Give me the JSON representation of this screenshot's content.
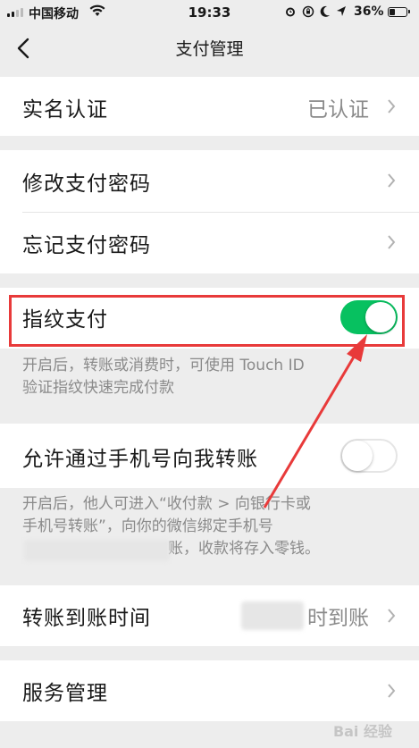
{
  "status_bar": {
    "carrier": "中国移动",
    "time": "19:33",
    "battery": "36%"
  },
  "nav": {
    "title": "支付管理"
  },
  "rows": {
    "real_name": {
      "label": "实名认证",
      "value": "已认证"
    },
    "change_password": {
      "label": "修改支付密码"
    },
    "forgot_password": {
      "label": "忘记支付密码"
    },
    "fingerprint_pay": {
      "label": "指纹支付",
      "enabled": true
    },
    "allow_phone_transfer": {
      "label": "允许通过手机号向我转账",
      "enabled": false
    },
    "transfer_arrival_time": {
      "label": "转账到账时间",
      "value": "时到账"
    },
    "service_management": {
      "label": "服务管理"
    }
  },
  "descriptions": {
    "fingerprint": [
      "开启后，转账或消费时，可使用 Touch ID",
      "验证指纹快速完成付款"
    ],
    "phone_transfer": [
      "开启后，他人可进入“收付款 > 向银行卡或",
      "手机号转账”，向你的微信绑定手机号",
      "账，收款将存入零钱。"
    ]
  },
  "colors": {
    "accent_green": "#07c160",
    "annotation_red": "#e83a3a"
  },
  "watermark": "Bai 经验"
}
